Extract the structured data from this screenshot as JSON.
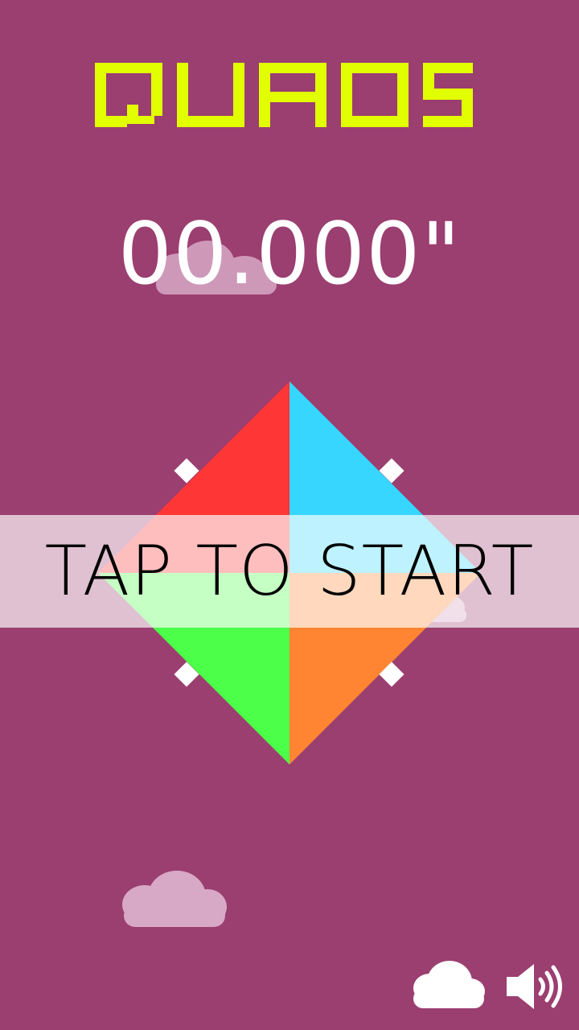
{
  "game": {
    "title": "QUADS",
    "timer": "00.000\"",
    "prompt": "TAP TO START"
  },
  "colors": {
    "background": "#9b3e70",
    "title": "#e2ff00",
    "quad_red": "#ff3636",
    "quad_blue": "#36d6ff",
    "quad_green": "#4cff48",
    "quad_orange": "#ff8533",
    "cloud": "#d8a9c6",
    "white": "#ffffff"
  },
  "icons": {
    "cloud_button": "cloud-icon",
    "sound_button": "speaker-icon"
  }
}
